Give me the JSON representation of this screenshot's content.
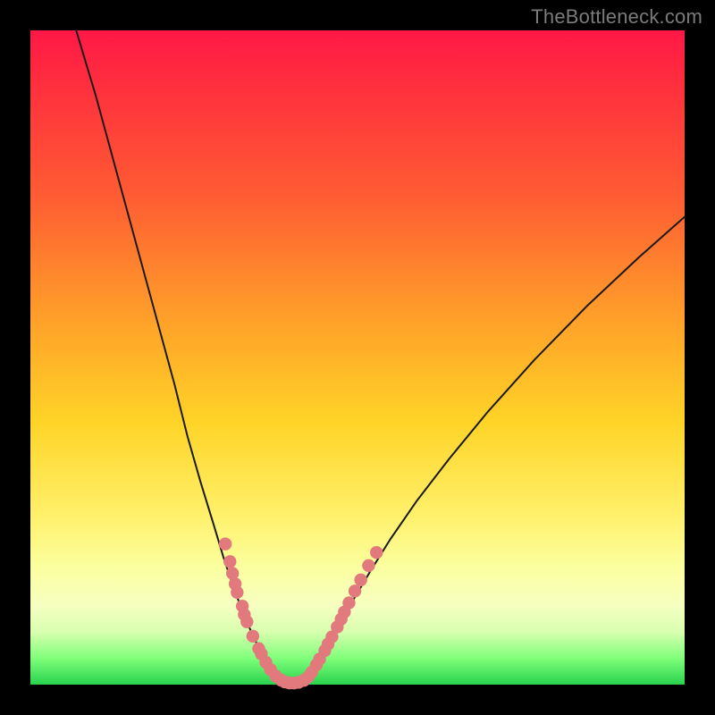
{
  "watermark": "TheBottleneck.com",
  "chart_data": {
    "type": "line",
    "title": "",
    "xlabel": "",
    "ylabel": "",
    "xlim": [
      0,
      100
    ],
    "ylim": [
      0,
      100
    ],
    "series": [
      {
        "name": "curve-left",
        "x": [
          7,
          10,
          13,
          16,
          19,
          22,
          24,
          26,
          28,
          29.5,
          31,
          32.5,
          34,
          35.5,
          36.6,
          37.5,
          38.3
        ],
        "y": [
          100,
          90,
          79,
          68,
          57,
          46,
          38,
          31,
          24.5,
          19.5,
          15,
          11,
          7.5,
          4.5,
          2.5,
          1.2,
          0.4
        ]
      },
      {
        "name": "curve-right",
        "x": [
          41.7,
          42.5,
          43.4,
          44.5,
          46,
          47.5,
          49.5,
          52,
          55,
          59,
          64,
          70,
          77,
          85,
          93,
          100
        ],
        "y": [
          0.4,
          1.2,
          2.6,
          4.3,
          6.8,
          9.6,
          13.2,
          17.4,
          22.2,
          28,
          34.5,
          41.8,
          49.6,
          57.8,
          65.3,
          71.5
        ]
      },
      {
        "name": "valley-floor",
        "x": [
          38.3,
          39,
          40,
          41,
          41.7
        ],
        "y": [
          0.4,
          0.15,
          0.1,
          0.15,
          0.4
        ]
      }
    ],
    "dots": {
      "name": "salmon-dots",
      "color": "#e27a7d",
      "points": [
        {
          "x": 29.8,
          "y": 21.5
        },
        {
          "x": 30.5,
          "y": 18.8
        },
        {
          "x": 30.9,
          "y": 17.0
        },
        {
          "x": 31.3,
          "y": 15.4
        },
        {
          "x": 31.6,
          "y": 14.1
        },
        {
          "x": 32.4,
          "y": 12.0
        },
        {
          "x": 32.7,
          "y": 10.7
        },
        {
          "x": 33.1,
          "y": 9.6
        },
        {
          "x": 34.0,
          "y": 7.4
        },
        {
          "x": 34.9,
          "y": 5.5
        },
        {
          "x": 35.3,
          "y": 4.7
        },
        {
          "x": 36.0,
          "y": 3.4
        },
        {
          "x": 36.7,
          "y": 2.3
        },
        {
          "x": 37.5,
          "y": 1.3
        },
        {
          "x": 38.3,
          "y": 0.7
        },
        {
          "x": 38.9,
          "y": 0.4
        },
        {
          "x": 39.6,
          "y": 0.25
        },
        {
          "x": 40.3,
          "y": 0.25
        },
        {
          "x": 41.0,
          "y": 0.35
        },
        {
          "x": 41.8,
          "y": 0.65
        },
        {
          "x": 42.5,
          "y": 1.2
        },
        {
          "x": 43.0,
          "y": 1.9
        },
        {
          "x": 43.7,
          "y": 3.0
        },
        {
          "x": 44.2,
          "y": 3.9
        },
        {
          "x": 45.0,
          "y": 5.2
        },
        {
          "x": 45.5,
          "y": 6.2
        },
        {
          "x": 46.1,
          "y": 7.3
        },
        {
          "x": 46.9,
          "y": 8.8
        },
        {
          "x": 47.5,
          "y": 10.0
        },
        {
          "x": 48.0,
          "y": 11.1
        },
        {
          "x": 48.7,
          "y": 12.5
        },
        {
          "x": 49.6,
          "y": 14.3
        },
        {
          "x": 50.5,
          "y": 16.0
        },
        {
          "x": 51.7,
          "y": 18.2
        },
        {
          "x": 52.9,
          "y": 20.2
        }
      ]
    },
    "curve_stroke": "#1a1a1a",
    "curve_width": 2
  }
}
